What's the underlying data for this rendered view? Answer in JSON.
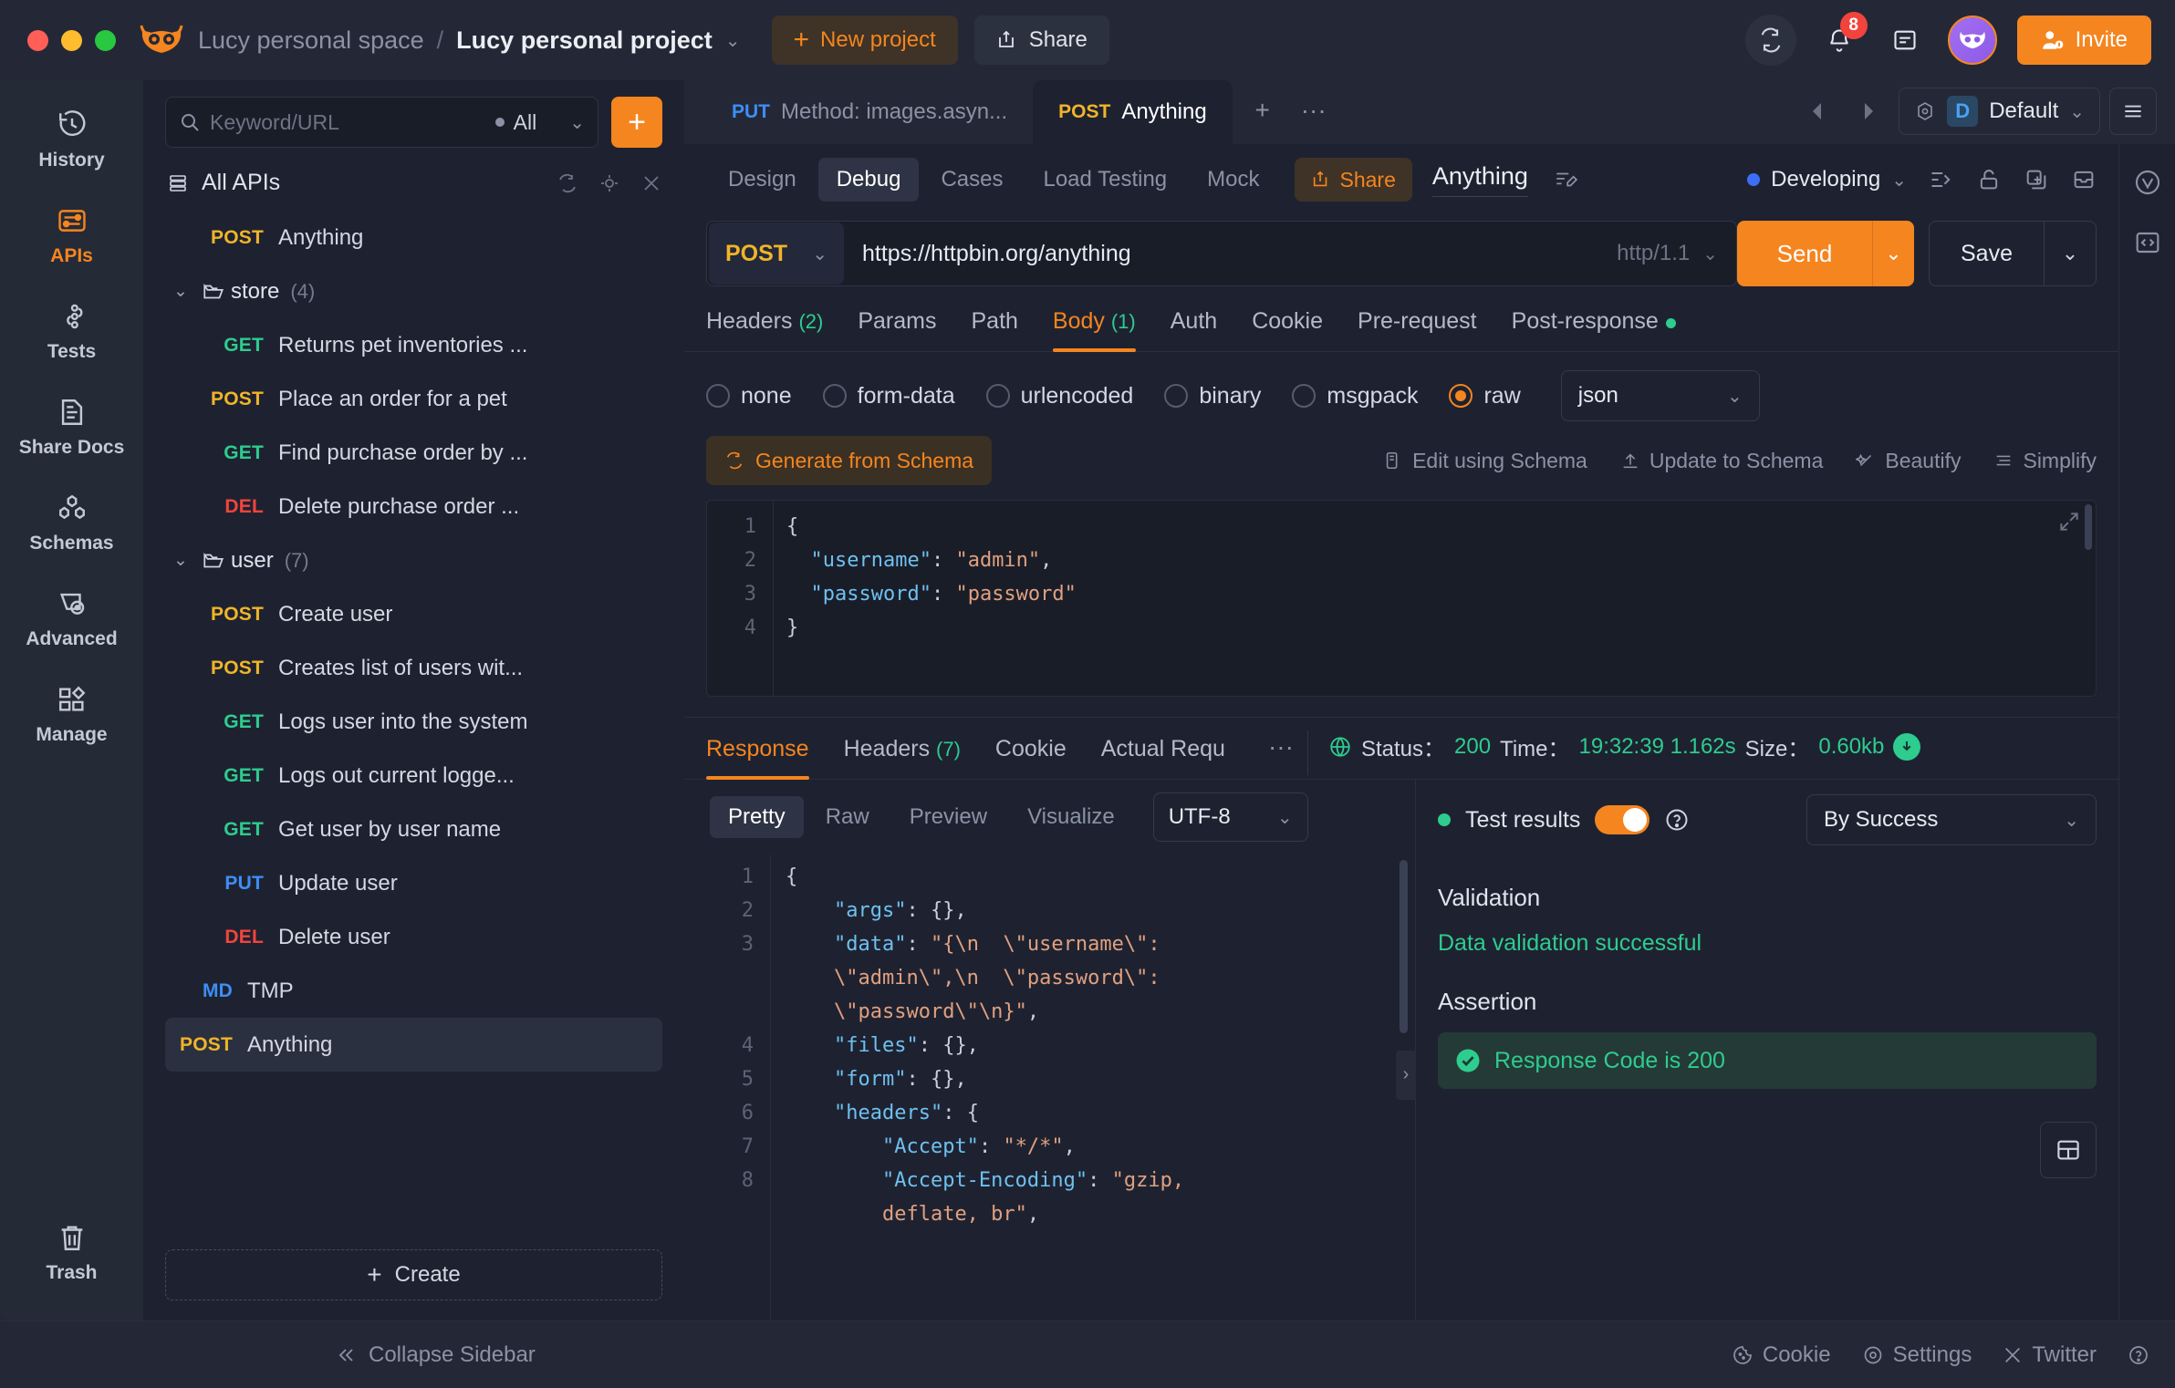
{
  "titlebar": {
    "space_name": "Lucy personal space",
    "separator": "/",
    "project_name": "Lucy personal project",
    "new_project_label": "New project",
    "share_label": "Share",
    "notification_count": "8",
    "invite_label": "Invite"
  },
  "rail": {
    "items": [
      {
        "label": "History",
        "icon": "history-icon",
        "active": false
      },
      {
        "label": "APIs",
        "icon": "apis-icon",
        "active": true
      },
      {
        "label": "Tests",
        "icon": "tests-icon",
        "active": false
      },
      {
        "label": "Share Docs",
        "icon": "share-docs-icon",
        "active": false
      },
      {
        "label": "Schemas",
        "icon": "schemas-icon",
        "active": false
      },
      {
        "label": "Advanced",
        "icon": "advanced-icon",
        "active": false
      },
      {
        "label": "Manage",
        "icon": "manage-icon",
        "active": false
      }
    ],
    "trash_label": "Trash"
  },
  "sidebar": {
    "search_placeholder": "Keyword/URL",
    "search_value": "",
    "filter_label": "All",
    "all_apis_label": "All APIs",
    "create_label": "Create",
    "tree": [
      {
        "type": "api",
        "method": "POST",
        "name": "Anything",
        "indent": 1,
        "selected": false
      },
      {
        "type": "folder",
        "method": "",
        "name": "store",
        "count": "(4)",
        "indent": 0,
        "expanded": true
      },
      {
        "type": "api",
        "method": "GET",
        "name": "Returns pet inventories ...",
        "indent": 1,
        "selected": false
      },
      {
        "type": "api",
        "method": "POST",
        "name": "Place an order for a pet",
        "indent": 1,
        "selected": false
      },
      {
        "type": "api",
        "method": "GET",
        "name": "Find purchase order by ...",
        "indent": 1,
        "selected": false
      },
      {
        "type": "api",
        "method": "DEL",
        "name": "Delete purchase order ...",
        "indent": 1,
        "selected": false
      },
      {
        "type": "folder",
        "method": "",
        "name": "user",
        "count": "(7)",
        "indent": 0,
        "expanded": true
      },
      {
        "type": "api",
        "method": "POST",
        "name": "Create user",
        "indent": 1,
        "selected": false
      },
      {
        "type": "api",
        "method": "POST",
        "name": "Creates list of users wit...",
        "indent": 1,
        "selected": false
      },
      {
        "type": "api",
        "method": "GET",
        "name": "Logs user into the system",
        "indent": 1,
        "selected": false
      },
      {
        "type": "api",
        "method": "GET",
        "name": "Logs out current logge...",
        "indent": 1,
        "selected": false
      },
      {
        "type": "api",
        "method": "GET",
        "name": "Get user by user name",
        "indent": 1,
        "selected": false
      },
      {
        "type": "api",
        "method": "PUT",
        "name": "Update user",
        "indent": 1,
        "selected": false
      },
      {
        "type": "api",
        "method": "DEL",
        "name": "Delete user",
        "indent": 1,
        "selected": false
      },
      {
        "type": "api",
        "method": "MD",
        "name": "TMP",
        "indent": 0,
        "selected": false
      },
      {
        "type": "api",
        "method": "POST",
        "name": "Anything",
        "indent": 0,
        "selected": true
      }
    ]
  },
  "doc_tabs": [
    {
      "method": "PUT",
      "title": "Method: images.asyn...",
      "active": false
    },
    {
      "method": "POST",
      "title": "Anything",
      "active": true
    }
  ],
  "environment": {
    "chip": "D",
    "name": "Default"
  },
  "subtabs": {
    "items": [
      {
        "label": "Design",
        "active": false
      },
      {
        "label": "Debug",
        "active": true
      },
      {
        "label": "Cases",
        "active": false
      },
      {
        "label": "Load Testing",
        "active": false
      },
      {
        "label": "Mock",
        "active": false
      }
    ],
    "share_label": "Share",
    "api_title": "Anything",
    "status_label": "Developing"
  },
  "request": {
    "method": "POST",
    "url": "https://httpbin.org/anything",
    "protocol": "http/1.1",
    "send_label": "Send",
    "save_label": "Save",
    "tabs": [
      {
        "label": "Headers",
        "count": "(2)",
        "active": false,
        "dot": false
      },
      {
        "label": "Params",
        "count": "",
        "active": false,
        "dot": false
      },
      {
        "label": "Path",
        "count": "",
        "active": false,
        "dot": false
      },
      {
        "label": "Body",
        "count": "(1)",
        "active": true,
        "dot": false
      },
      {
        "label": "Auth",
        "count": "",
        "active": false,
        "dot": false
      },
      {
        "label": "Cookie",
        "count": "",
        "active": false,
        "dot": false
      },
      {
        "label": "Pre-request",
        "count": "",
        "active": false,
        "dot": false
      },
      {
        "label": "Post-response",
        "count": "",
        "active": false,
        "dot": true
      }
    ],
    "body_types": [
      {
        "label": "none",
        "selected": false
      },
      {
        "label": "form-data",
        "selected": false
      },
      {
        "label": "urlencoded",
        "selected": false
      },
      {
        "label": "binary",
        "selected": false
      },
      {
        "label": "msgpack",
        "selected": false
      },
      {
        "label": "raw",
        "selected": true
      }
    ],
    "raw_format": "json",
    "generate_from_schema_label": "Generate from Schema",
    "schema_actions": [
      {
        "label": "Edit using Schema",
        "icon": "edit-schema-icon"
      },
      {
        "label": "Update to Schema",
        "icon": "upload-icon"
      },
      {
        "label": "Beautify",
        "icon": "wand-icon"
      },
      {
        "label": "Simplify",
        "icon": "simplify-icon"
      }
    ],
    "body_editor": {
      "line_numbers": [
        "1",
        "2",
        "3",
        "4"
      ],
      "lines": [
        [
          {
            "t": "{",
            "c": "p"
          }
        ],
        [
          {
            "t": "  ",
            "c": "p"
          },
          {
            "t": "\"username\"",
            "c": "k"
          },
          {
            "t": ": ",
            "c": "p"
          },
          {
            "t": "\"admin\"",
            "c": "s"
          },
          {
            "t": ",",
            "c": "p"
          }
        ],
        [
          {
            "t": "  ",
            "c": "p"
          },
          {
            "t": "\"password\"",
            "c": "k"
          },
          {
            "t": ": ",
            "c": "p"
          },
          {
            "t": "\"password\"",
            "c": "s"
          }
        ],
        [
          {
            "t": "}",
            "c": "p"
          }
        ]
      ]
    }
  },
  "response": {
    "tabs": [
      {
        "label": "Response",
        "count": "",
        "active": true
      },
      {
        "label": "Headers",
        "count": "(7)",
        "active": false
      },
      {
        "label": "Cookie",
        "count": "",
        "active": false
      },
      {
        "label": "Actual Requ",
        "count": "",
        "active": false
      }
    ],
    "status_label": "Status：",
    "status_value": "200",
    "time_label": "Time：",
    "time_value": "19:32:39 1.162s",
    "size_label": "Size：",
    "size_value": "0.60kb",
    "view_modes": [
      {
        "label": "Pretty",
        "active": true
      },
      {
        "label": "Raw",
        "active": false
      },
      {
        "label": "Preview",
        "active": false
      },
      {
        "label": "Visualize",
        "active": false
      }
    ],
    "encoding": "UTF-8",
    "body_editor": {
      "rows": [
        {
          "num": "1",
          "segs": [
            {
              "t": "{",
              "c": "p"
            }
          ]
        },
        {
          "num": "2",
          "segs": [
            {
              "t": "    ",
              "c": "p"
            },
            {
              "t": "\"args\"",
              "c": "k"
            },
            {
              "t": ": {},",
              "c": "p"
            }
          ]
        },
        {
          "num": "3",
          "segs": [
            {
              "t": "    ",
              "c": "p"
            },
            {
              "t": "\"data\"",
              "c": "k"
            },
            {
              "t": ": ",
              "c": "p"
            },
            {
              "t": "\"{\\n  \\\"username\\\":",
              "c": "s"
            }
          ]
        },
        {
          "num": "",
          "segs": [
            {
              "t": "    ",
              "c": "p"
            },
            {
              "t": "\\\"admin\\\",\\n  \\\"password\\\":",
              "c": "s"
            }
          ]
        },
        {
          "num": "",
          "segs": [
            {
              "t": "    ",
              "c": "p"
            },
            {
              "t": "\\\"password\\\"\\n}\"",
              "c": "s"
            },
            {
              "t": ",",
              "c": "p"
            }
          ]
        },
        {
          "num": "4",
          "segs": [
            {
              "t": "    ",
              "c": "p"
            },
            {
              "t": "\"files\"",
              "c": "k"
            },
            {
              "t": ": {},",
              "c": "p"
            }
          ]
        },
        {
          "num": "5",
          "segs": [
            {
              "t": "    ",
              "c": "p"
            },
            {
              "t": "\"form\"",
              "c": "k"
            },
            {
              "t": ": {},",
              "c": "p"
            }
          ]
        },
        {
          "num": "6",
          "segs": [
            {
              "t": "    ",
              "c": "p"
            },
            {
              "t": "\"headers\"",
              "c": "k"
            },
            {
              "t": ": {",
              "c": "p"
            }
          ]
        },
        {
          "num": "7",
          "segs": [
            {
              "t": "        ",
              "c": "p"
            },
            {
              "t": "\"Accept\"",
              "c": "k"
            },
            {
              "t": ": ",
              "c": "p"
            },
            {
              "t": "\"*/*\"",
              "c": "s"
            },
            {
              "t": ",",
              "c": "p"
            }
          ]
        },
        {
          "num": "8",
          "segs": [
            {
              "t": "        ",
              "c": "p"
            },
            {
              "t": "\"Accept-Encoding\"",
              "c": "k"
            },
            {
              "t": ": ",
              "c": "p"
            },
            {
              "t": "\"gzip,",
              "c": "s"
            }
          ]
        },
        {
          "num": "",
          "segs": [
            {
              "t": "        ",
              "c": "p"
            },
            {
              "t": "deflate, br\"",
              "c": "s"
            },
            {
              "t": ",",
              "c": "p"
            }
          ]
        }
      ]
    }
  },
  "test_results": {
    "label": "Test results",
    "filter": "By Success",
    "validation_title": "Validation",
    "validation_message": "Data validation successful",
    "assertion_title": "Assertion",
    "assertions": [
      {
        "text": "Response Code is 200",
        "passed": true
      }
    ]
  },
  "statusbar": {
    "collapse_label": "Collapse Sidebar",
    "items": [
      {
        "label": "Cookie",
        "icon": "cookie-icon"
      },
      {
        "label": "Settings",
        "icon": "gear-icon"
      },
      {
        "label": "Twitter",
        "icon": "twitter-x-icon"
      }
    ]
  },
  "colors": {
    "accent": "#f5851f",
    "success": "#2ecc8f",
    "danger": "#f2443d",
    "info": "#3d8ef7",
    "warning": "#f0b429"
  }
}
